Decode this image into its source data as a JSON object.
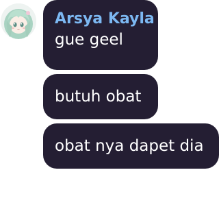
{
  "chat": {
    "sender_name": "Arsya Kayla",
    "avatar_icon": "anime-girl-avatar",
    "colors": {
      "bubble_bg": "#241e33",
      "sender_name": "#7cb8f2",
      "message_text": "#ffffff"
    },
    "messages": [
      {
        "text": "gue geel"
      },
      {
        "text": "butuh obat"
      },
      {
        "text": "obat nya dapet dia"
      }
    ]
  }
}
